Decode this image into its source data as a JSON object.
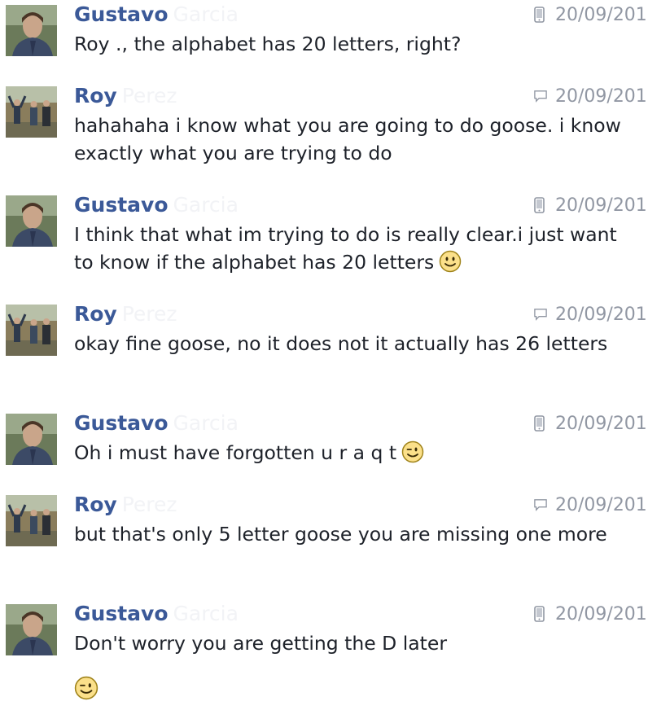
{
  "messages": [
    {
      "sender": "Gustavo",
      "source": "mobile",
      "time": "20/09/201",
      "text": "Roy ., the alphabet has 20 letters, right?",
      "emoticon": false
    },
    {
      "sender": "Roy",
      "source": "chat",
      "time": "20/09/201",
      "text": "hahahaha i know what you are going to do goose. i know exactly what you are trying to do",
      "emoticon": false
    },
    {
      "sender": "Gustavo",
      "source": "mobile",
      "time": "20/09/201",
      "text": "I think that what im trying to do is really clear.i just want to know if the alphabet has 20 letters",
      "emoticon": "smile"
    },
    {
      "sender": "Roy",
      "source": "chat",
      "time": "20/09/201",
      "text": "okay fine goose, no it does not it actually has 26 letters",
      "emoticon": false
    },
    {
      "sender": "Gustavo",
      "source": "mobile",
      "time": "20/09/201",
      "text": "Oh i must have forgotten u r a q t",
      "emoticon": "wink"
    },
    {
      "sender": "Roy",
      "source": "chat",
      "time": "20/09/201",
      "text": "but that's only 5 letter goose you are missing one more",
      "emoticon": false
    },
    {
      "sender": "Gustavo",
      "source": "mobile",
      "time": "20/09/201",
      "text": "Don't worry you are getting the D later",
      "emoticon": false
    }
  ],
  "trailing_emoticon": "wink",
  "colors": {
    "name": "#3b5998",
    "meta": "#9197a3",
    "text": "#1d2129"
  }
}
